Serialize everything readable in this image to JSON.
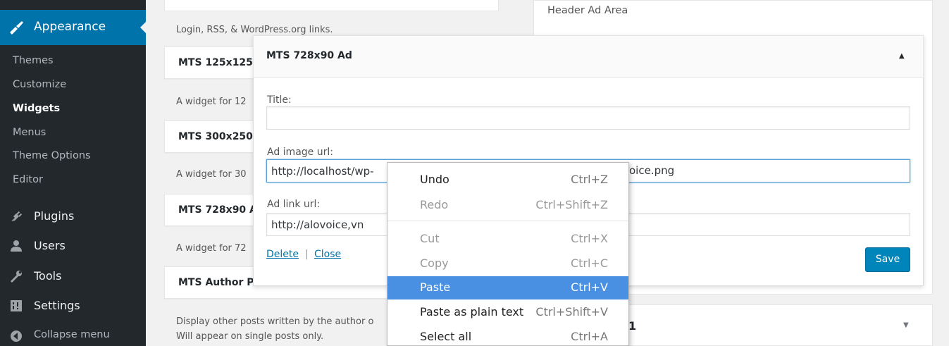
{
  "sidebar": {
    "appearance": "Appearance",
    "submenu": [
      "Themes",
      "Customize",
      "Widgets",
      "Menus",
      "Theme Options",
      "Editor"
    ],
    "current": "Widgets",
    "main": [
      {
        "label": "Plugins",
        "icon": "plugin-icon"
      },
      {
        "label": "Users",
        "icon": "users-icon"
      },
      {
        "label": "Tools",
        "icon": "wrench-icon"
      },
      {
        "label": "Settings",
        "icon": "settings-icon"
      },
      {
        "label": "Collapse menu",
        "icon": "collapse-icon"
      }
    ]
  },
  "available_widgets": {
    "top_desc": "Login, RSS, & WordPress.org links.",
    "items": [
      {
        "title": "MTS 125x125",
        "desc": "A widget for 12"
      },
      {
        "title": "MTS 300x250",
        "desc": "A widget for 30"
      },
      {
        "title": "MTS 728x90 A",
        "desc": "A widget for 72"
      },
      {
        "title": "MTS Author Posts",
        "desc": "Display other posts written by the author o"
      }
    ],
    "extra_desc": "Will appear on single posts only."
  },
  "sidebar_area": {
    "title": "Header Ad Area",
    "bottom_widget_title": "1"
  },
  "panel": {
    "title": "MTS 728x90 Ad",
    "title_label": "Title:",
    "title_value": "",
    "image_label": "Ad image url:",
    "image_value": "http://localhost/wp-",
    "image_value_tail": "oice.png",
    "link_label": "Ad link url:",
    "link_value": "http://alovoice,vn",
    "delete": "Delete",
    "separator": "|",
    "close": "Close",
    "save": "Save"
  },
  "context_menu": {
    "items": [
      {
        "label": "Undo",
        "shortcut": "Ctrl+Z",
        "state": "enabled"
      },
      {
        "label": "Redo",
        "shortcut": "Ctrl+Shift+Z",
        "state": "disabled"
      },
      {
        "label": "Cut",
        "shortcut": "Ctrl+X",
        "state": "disabled"
      },
      {
        "label": "Copy",
        "shortcut": "Ctrl+C",
        "state": "disabled"
      },
      {
        "label": "Paste",
        "shortcut": "Ctrl+V",
        "state": "hover"
      },
      {
        "label": "Paste as plain text",
        "shortcut": "Ctrl+Shift+V",
        "state": "enabled"
      },
      {
        "label": "Select all",
        "shortcut": "Ctrl+A",
        "state": "enabled"
      }
    ]
  },
  "colors": {
    "admin_bar": "#23282d",
    "accent": "#0073aa",
    "menu_hover": "#4a90e2",
    "button": "#0085ba"
  }
}
